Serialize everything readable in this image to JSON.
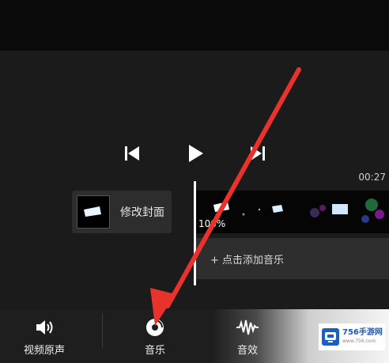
{
  "player": {
    "time": "00:27",
    "prev_icon": "skip-previous-icon",
    "play_icon": "play-icon",
    "next_icon": "skip-next-icon"
  },
  "cover": {
    "label": "修改封面"
  },
  "timeline": {
    "percent": "100%",
    "add_music": "+ 点击添加音乐"
  },
  "toolbar": {
    "items": [
      {
        "label": "视频原声",
        "icon": "speaker-icon"
      },
      {
        "label": "音乐",
        "icon": "music-disc-icon"
      },
      {
        "label": "音效",
        "icon": "waveform-icon"
      }
    ]
  },
  "watermark": {
    "text": "756手游网",
    "sub": "www.756.com"
  },
  "colors": {
    "arrow": "#e8322b",
    "background": "#1b1b1b",
    "accent_blue": "#1a5fc8"
  }
}
